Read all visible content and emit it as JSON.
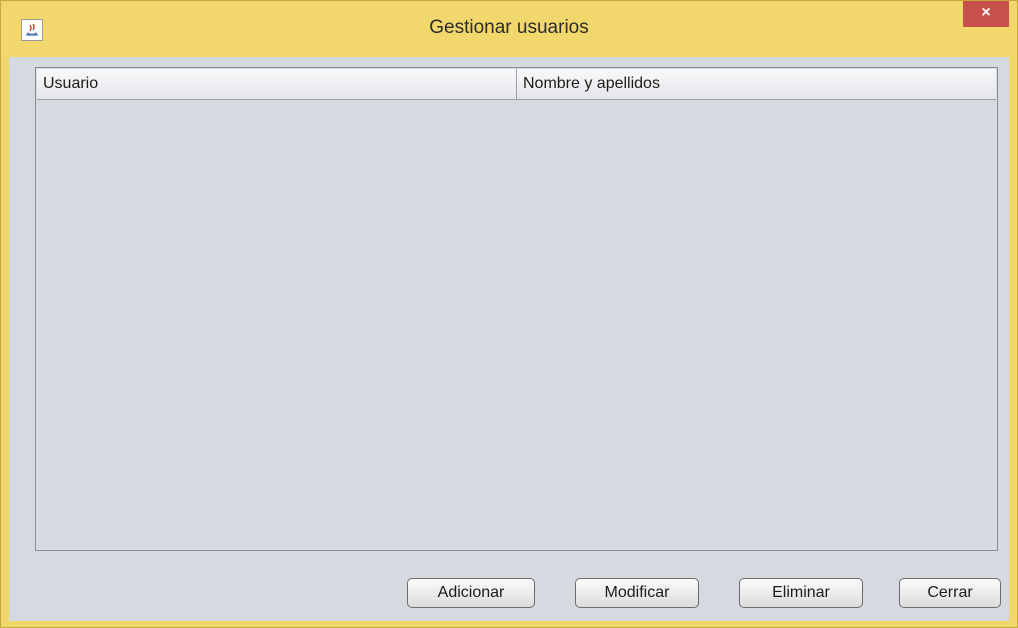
{
  "window": {
    "title": "Gestionar usuarios",
    "close_label": "×"
  },
  "table": {
    "columns": [
      "Usuario",
      "Nombre y apellidos"
    ],
    "rows": []
  },
  "buttons": {
    "add": "Adicionar",
    "modify": "Modificar",
    "delete": "Eliminar",
    "close": "Cerrar"
  },
  "colors": {
    "title_bar": "#f2d86c",
    "close_button": "#c7504b",
    "panel_bg": "#d6d9df"
  },
  "icons": {
    "app": "java-coffee-icon",
    "close": "close-icon"
  }
}
